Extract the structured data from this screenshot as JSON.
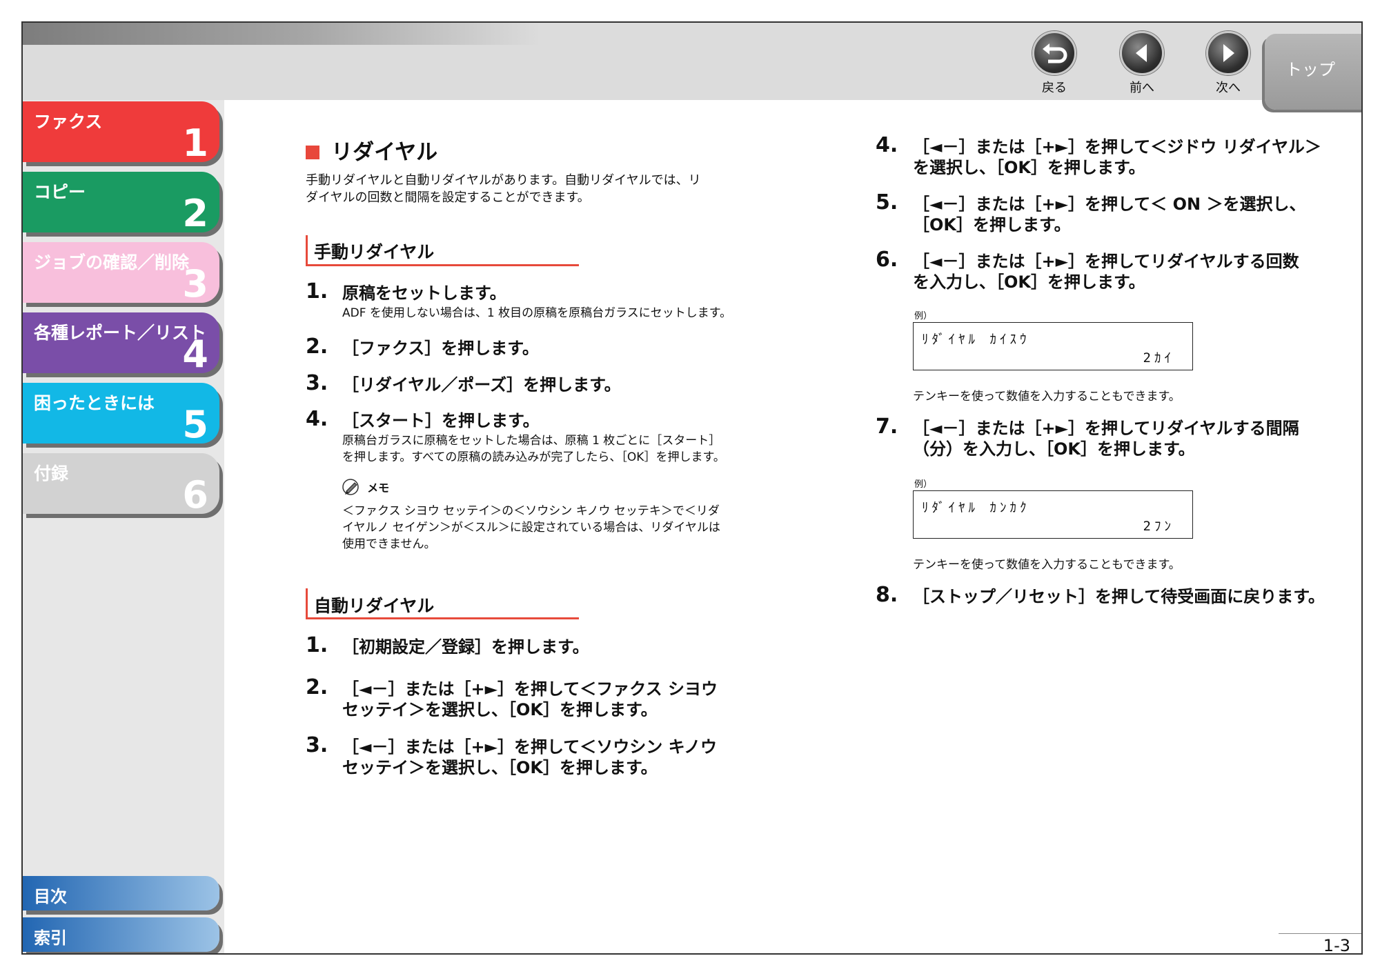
{
  "header": {
    "back_label": "戻る",
    "prev_label": "前へ",
    "next_label": "次へ",
    "top_label": "トップ"
  },
  "sidebar": {
    "tabs": [
      {
        "label": "ファクス",
        "number": "1",
        "color": "#ef3b3b"
      },
      {
        "label": "コピー",
        "number": "2",
        "color": "#1a9b62"
      },
      {
        "label": "ジョブの確認／削除",
        "number": "3",
        "color": "#f8bfdc"
      },
      {
        "label": "各種レポート／リスト",
        "number": "4",
        "color": "#7a4ea8"
      },
      {
        "label": "困ったときには",
        "number": "5",
        "color": "#12b8e6"
      },
      {
        "label": "付録",
        "number": "6",
        "color": "#d2d2d2"
      }
    ],
    "bottom": {
      "contents_label": "目次",
      "index_label": "索引"
    }
  },
  "main": {
    "title": "リダイヤル",
    "intro_1": "手動リダイヤルと自動リダイヤルがあります。自動リダイヤルでは、リ",
    "intro_2": "ダイヤルの回数と間隔を設定することができます。",
    "manual": {
      "heading": "手動リダイヤル",
      "steps": [
        {
          "num": "1.",
          "text": "原稿をセットします。",
          "note": "ADF を使用しない場合は、1 枚目の原稿を原稿台ガラスにセットします。"
        },
        {
          "num": "2.",
          "text": "［ファクス］を押します。"
        },
        {
          "num": "3.",
          "text": "［リダイヤル／ポーズ］を押します。"
        },
        {
          "num": "4.",
          "text": "［スタート］を押します。",
          "note_1": "原稿台ガラスに原稿をセットした場合は、原稿 1 枚ごとに［スタート］",
          "note_2": "を押します。すべての原稿の読み込みが完了したら、［OK］を押します。"
        }
      ],
      "memo": {
        "label": "メモ",
        "line_1": "＜ファクス シヨウ セッテイ＞の＜ソウシン キノウ セッテキ＞で＜リダ",
        "line_2": "イヤルノ セイゲン＞が＜スル＞に設定されている場合は、リダイヤルは",
        "line_3": "使用できません。"
      }
    },
    "auto": {
      "heading": "自動リダイヤル",
      "steps": [
        {
          "num": "1.",
          "line_1": "［初期設定／登録］を押します。"
        },
        {
          "num": "2.",
          "line_1": "［◄－］または［+►］を押して＜ファクス シヨウ",
          "line_2": "セッテイ＞を選択し、［OK］を押します。"
        },
        {
          "num": "3.",
          "line_1": "［◄－］または［+►］を押して＜ソウシン キノウ",
          "line_2": "セッテイ＞を選択し、［OK］を押します。"
        },
        {
          "num": "4.",
          "line_1": "［◄－］または［+►］を押して＜ジドウ リダイヤル＞",
          "line_2": "を選択し、［OK］を押します。"
        },
        {
          "num": "5.",
          "line_1": "［◄－］または［+►］を押して＜ ON ＞を選択し、",
          "line_2": "［OK］を押します。"
        },
        {
          "num": "6.",
          "line_1": "［◄－］または［+►］を押してリダイヤルする回数",
          "line_2": "を入力し、［OK］を押します。"
        },
        {
          "num": "7.",
          "line_1": "［◄－］または［+►］を押してリダイヤルする間隔",
          "line_2": "（分）を入力し、［OK］を押します。"
        },
        {
          "num": "8.",
          "line_1": "［ストップ／リセット］を押して待受画面に戻ります。"
        }
      ],
      "example_1": {
        "label": "例）",
        "line_1": "ﾘﾀﾞｲﾔﾙ ｶｲｽｳ",
        "line_2": "2ｶｲ",
        "note": "テンキーを使って数値を入力することもできます。"
      },
      "example_2": {
        "label": "例）",
        "line_1": "ﾘﾀﾞｲﾔﾙ ｶﾝｶｸ",
        "line_2": "2ﾌﾝ",
        "note": "テンキーを使って数値を入力することもできます。"
      }
    }
  },
  "footer": {
    "page_number": "1-3"
  }
}
